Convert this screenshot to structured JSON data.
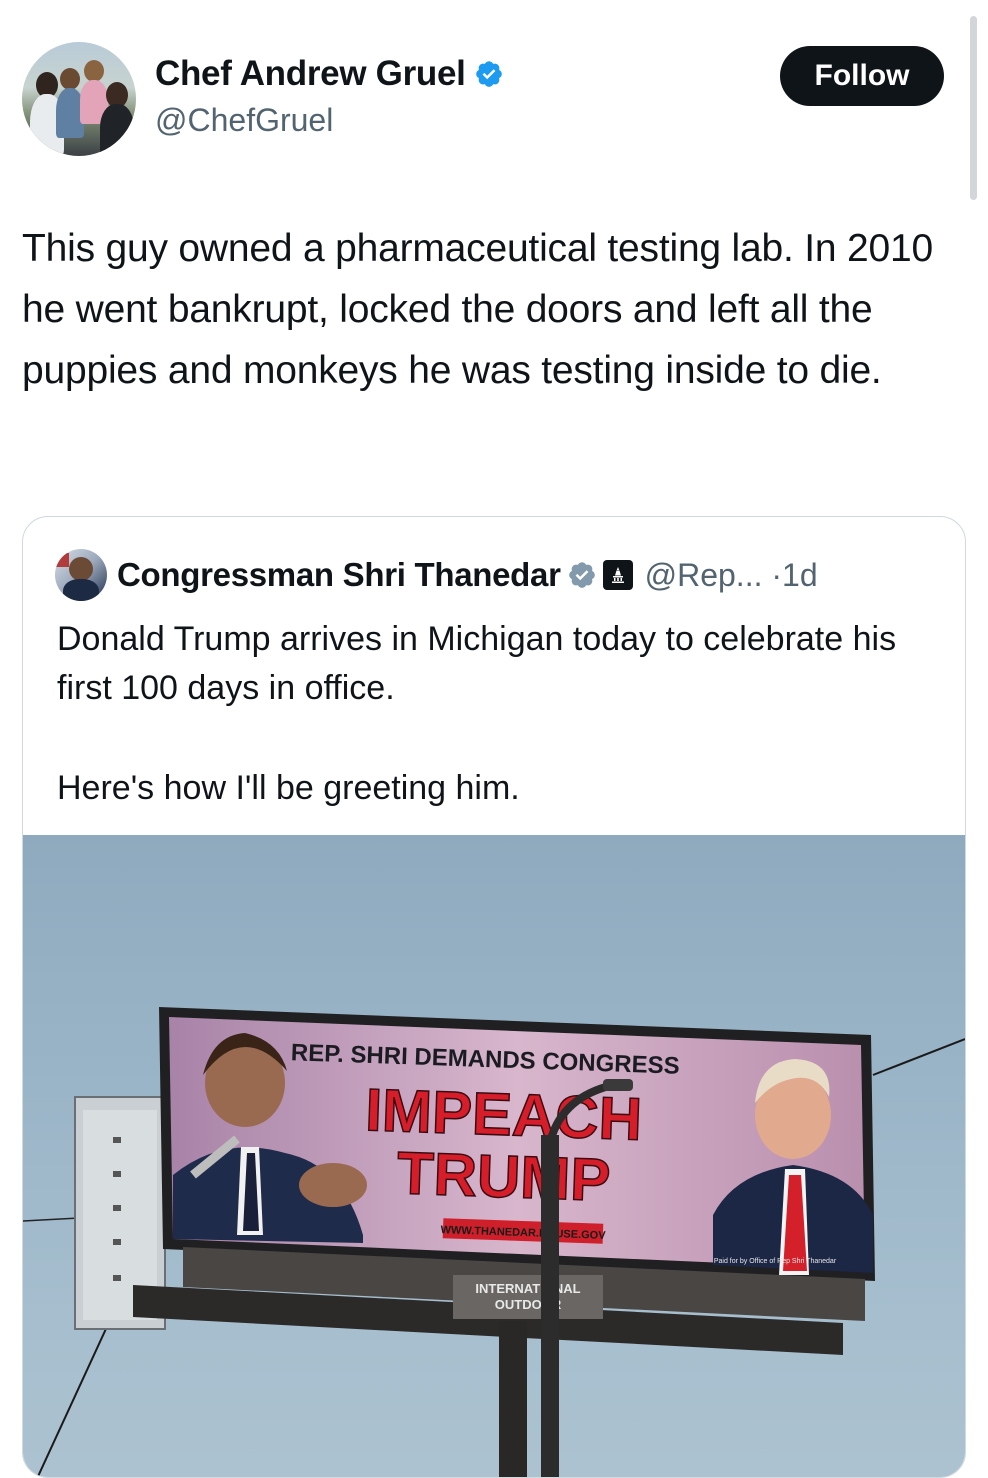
{
  "tweet": {
    "author": {
      "display_name": "Chef Andrew Gruel",
      "handle": "@ChefGruel",
      "verified": true
    },
    "follow_label": "Follow",
    "text": "This guy owned a pharmaceutical testing lab. In 2010 he went bankrupt, locked the doors and left all the puppies and monkeys he was testing inside to die."
  },
  "quoted_tweet": {
    "author": {
      "display_name": "Congressman Shri Thanedar",
      "handle": "@Rep...",
      "time": "1d",
      "separator": "·",
      "verified": true
    },
    "text_line1": "Donald Trump arrives in Michigan today to celebrate his first 100 days in office.",
    "text_line2": "Here's how I'll be greeting him.",
    "billboard": {
      "headline_small": "REP. SHRI DEMANDS CONGRESS",
      "headline_big_1": "IMPEACH",
      "headline_big_2": "TRUMP",
      "url": "WWW.THANEDAR.HOUSE.GOV",
      "disclaimer": "Paid for by Office of Rep Shri Thanedar",
      "company_1": "INTERNATIONAL",
      "company_2": "OUTDOOR"
    }
  },
  "colors": {
    "verified_blue": "#1d9bf0",
    "verified_gray": "#829aab",
    "text_primary": "#0f1419",
    "text_secondary": "#536471",
    "button_dark": "#0f1419"
  }
}
